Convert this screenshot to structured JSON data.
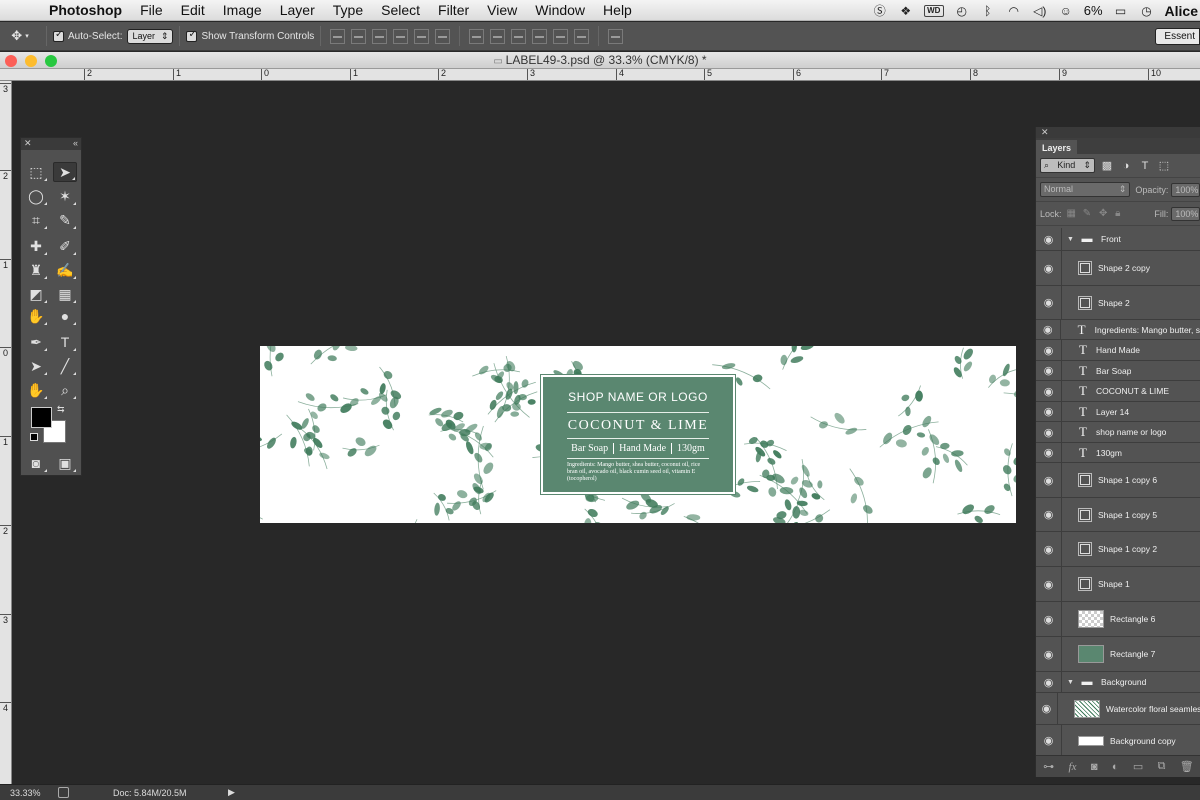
{
  "menubar": {
    "app": "Photoshop",
    "items": [
      "File",
      "Edit",
      "Image",
      "Layer",
      "Type",
      "Select",
      "Filter",
      "View",
      "Window",
      "Help"
    ],
    "battery": "6%",
    "user": "Alice",
    "wd_badge": "WD",
    "tray_icons": [
      "skype-icon",
      "dropbox-icon",
      "wd-icon",
      "time-machine-icon",
      "bluetooth-icon",
      "wifi-icon",
      "volume-icon",
      "battery-icon",
      "clock-icon"
    ]
  },
  "options": {
    "auto_select_label": "Auto-Select:",
    "auto_select_value": "Layer",
    "show_transform_label": "Show Transform Controls",
    "workspace": "Essent"
  },
  "document": {
    "title": "LABEL49-3.psd @ 33.3% (CMYK/8) *"
  },
  "rulers": {
    "top": [
      "2",
      "1",
      "0",
      "1",
      "2",
      "3",
      "4",
      "5",
      "6",
      "7",
      "8",
      "9",
      "10"
    ],
    "left": [
      "3",
      "2",
      "1",
      "0",
      "1",
      "2",
      "3",
      "4"
    ]
  },
  "label": {
    "shop_name": "SHOP NAME OR LOGO",
    "product": "COCONUT & LIME",
    "type": "Bar Soap",
    "made": "Hand Made",
    "weight": "130gm",
    "ingredients": "Ingredients: Mango butter, shea butter, coconut oil, rice bran oil, avocado oil, black cumin seed oil, vitamin E (tocopherol)",
    "accent_color": "#5a8770",
    "leaf_color": "#3e7a5a"
  },
  "layers_panel": {
    "tab": "Layers",
    "kind_label": "Kind",
    "blend_mode": "Normal",
    "opacity_label": "Opacity:",
    "opacity_value": "100%",
    "lock_label": "Lock:",
    "fill_label": "Fill:",
    "fill_value": "100%",
    "layers": [
      {
        "name": "Front",
        "type": "folder"
      },
      {
        "name": "Shape 2 copy",
        "type": "shape"
      },
      {
        "name": "Shape 2",
        "type": "shape"
      },
      {
        "name": "Ingredients: Mango butter, s...",
        "type": "text"
      },
      {
        "name": "Hand Made",
        "type": "text"
      },
      {
        "name": "Bar Soap",
        "type": "text"
      },
      {
        "name": "COCONUT & LIME",
        "type": "text"
      },
      {
        "name": "Layer 14",
        "type": "text"
      },
      {
        "name": "shop name or logo",
        "type": "text"
      },
      {
        "name": "130gm",
        "type": "text"
      },
      {
        "name": "Shape 1 copy 6",
        "type": "shape"
      },
      {
        "name": "Shape 1 copy 5",
        "type": "shape"
      },
      {
        "name": "Shape 1 copy 2",
        "type": "shape"
      },
      {
        "name": "Shape 1",
        "type": "shape"
      },
      {
        "name": "Rectangle 6",
        "type": "raster",
        "thumb": "checker"
      },
      {
        "name": "Rectangle 7",
        "type": "raster",
        "thumb": "green"
      },
      {
        "name": "Background",
        "type": "folder"
      },
      {
        "name": "Watercolor floral seamless p...",
        "type": "raster",
        "thumb": "floral"
      },
      {
        "name": "Background copy",
        "type": "raster",
        "thumb": "white"
      }
    ]
  },
  "status": {
    "zoom": "33.33%",
    "doc": "Doc: 5.84M/20.5M"
  }
}
